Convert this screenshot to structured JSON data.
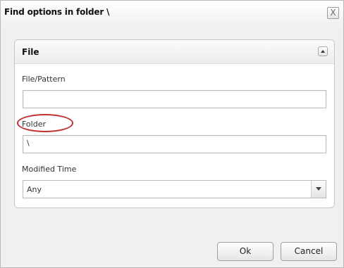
{
  "dialog": {
    "title": "Find options in folder \\",
    "close_label": "X"
  },
  "panel": {
    "title": "File",
    "file_pattern": {
      "label": "File/Pattern",
      "value": ""
    },
    "folder": {
      "label": "Folder",
      "value": "\\"
    },
    "modified_time": {
      "label": "Modified Time",
      "selected": "Any"
    }
  },
  "buttons": {
    "ok": "Ok",
    "cancel": "Cancel"
  },
  "annotation": {
    "color": "#c03030"
  }
}
